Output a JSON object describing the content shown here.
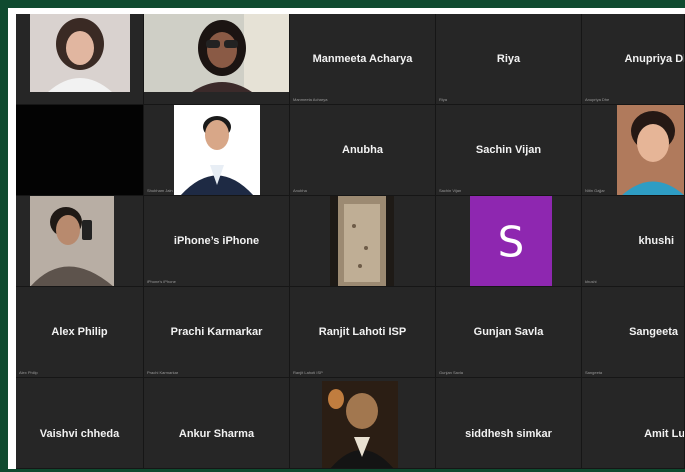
{
  "tiles": [
    {
      "name": "",
      "tag": "",
      "video": "woman-pink"
    },
    {
      "name": "",
      "tag": "",
      "video": "woman-glasses"
    },
    {
      "name": "Manmeeta Acharya",
      "tag": "Manmeeta Acharya"
    },
    {
      "name": "Riya",
      "tag": "Riya"
    },
    {
      "name": "Anupriya Dhe",
      "tag": "Anupriya Dhe"
    },
    {
      "name": "",
      "tag": "",
      "video": "black"
    },
    {
      "name": "",
      "tag": "Shubham Jain",
      "video": "man-suit"
    },
    {
      "name": "Anubha",
      "tag": "Anubha"
    },
    {
      "name": "Sachin Vijan",
      "tag": "Sachin Vijan"
    },
    {
      "name": "",
      "tag": "Nitin Gajjar",
      "video": "woman-smile"
    },
    {
      "name": "",
      "tag": "",
      "video": "man-selfie"
    },
    {
      "name": "iPhone’s iPhone",
      "tag": "iPhone’s iPhone"
    },
    {
      "name": "",
      "tag": "",
      "video": "wall"
    },
    {
      "name": "",
      "tag": "S",
      "video": "avatar-s"
    },
    {
      "name": "khushi",
      "tag": "khushi"
    },
    {
      "name": "Alex Philip",
      "tag": "Alex Philip"
    },
    {
      "name": "Prachi Karmarkar",
      "tag": "Prachi Karmarkar"
    },
    {
      "name": "Ranjit Lahoti ISP",
      "tag": "Ranjit Lahoti ISP"
    },
    {
      "name": "Gunjan Savla",
      "tag": "Gunjan Savla"
    },
    {
      "name": "Sangeeta",
      "tag": "Sangeeta"
    },
    {
      "name": "Vaishvi chheda",
      "tag": ""
    },
    {
      "name": "Ankur Sharma",
      "tag": ""
    },
    {
      "name": "",
      "tag": "",
      "video": "man-dark"
    },
    {
      "name": "siddhesh simkar",
      "tag": ""
    },
    {
      "name": "Amit Luvan",
      "tag": ""
    }
  ],
  "avatar": {
    "letter": "S",
    "color": "#8e27b0"
  }
}
